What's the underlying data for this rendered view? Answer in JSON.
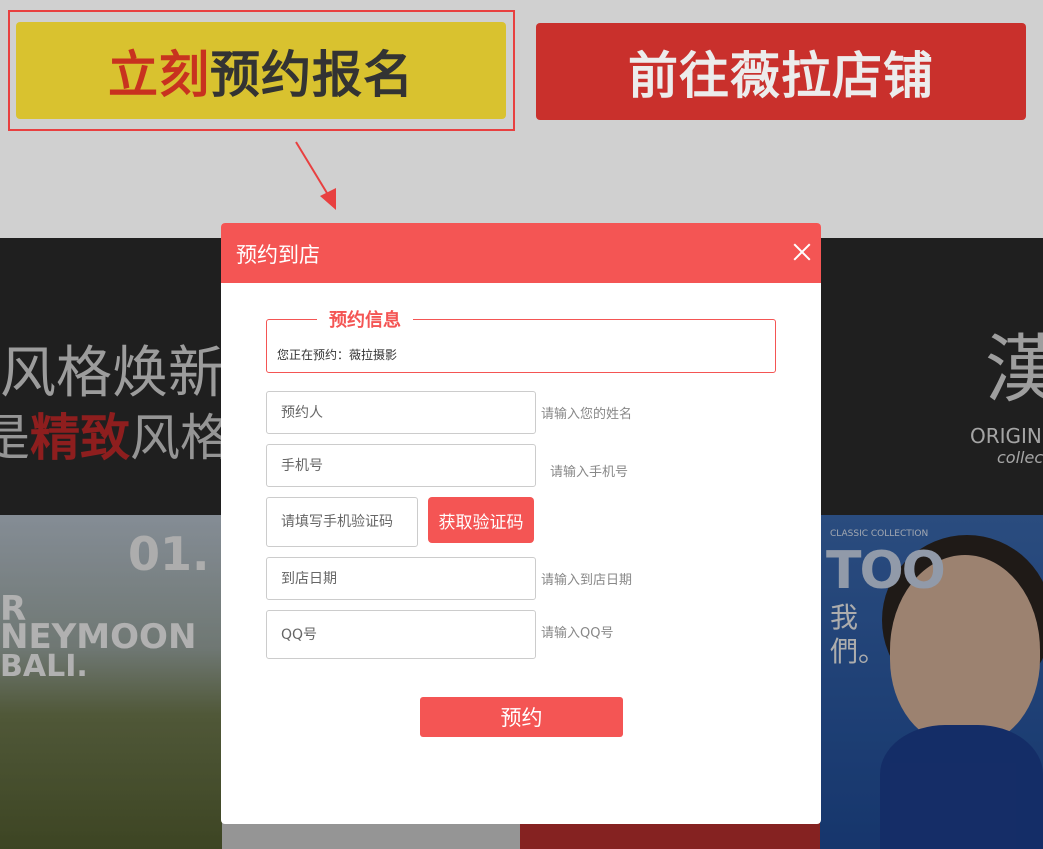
{
  "top_buttons": {
    "reserve_red": "立刻",
    "reserve_rest": "预约报名",
    "store": "前往薇拉店铺"
  },
  "banner": {
    "line1": "风格焕新",
    "line2_pre": "是",
    "line2_red": "精致",
    "line2_post": "风格约",
    "logo_glyph": "漢",
    "logo_text": "ORIGIN W",
    "logo_sub": "collec"
  },
  "photos": {
    "a_num": "01.",
    "a_t1": "R",
    "a_t2": "NEYMOON",
    "a_t3": "BALI.",
    "d_tag": "CLASSIC COLLECTION",
    "d_big": "TOO",
    "d_we": "我們。"
  },
  "modal": {
    "title": "预约到店",
    "info_legend": "预约信息",
    "info_text": "您正在预约：薇拉摄影",
    "name_placeholder": "预约人",
    "name_hint": "请输入您的姓名",
    "phone_placeholder": "手机号",
    "phone_hint": "请输入手机号",
    "code_placeholder": "请填写手机验证码",
    "code_button": "获取验证码",
    "date_placeholder": "到店日期",
    "date_hint": "请输入到店日期",
    "qq_placeholder": "QQ号",
    "qq_hint": "请输入QQ号",
    "submit": "预约"
  }
}
